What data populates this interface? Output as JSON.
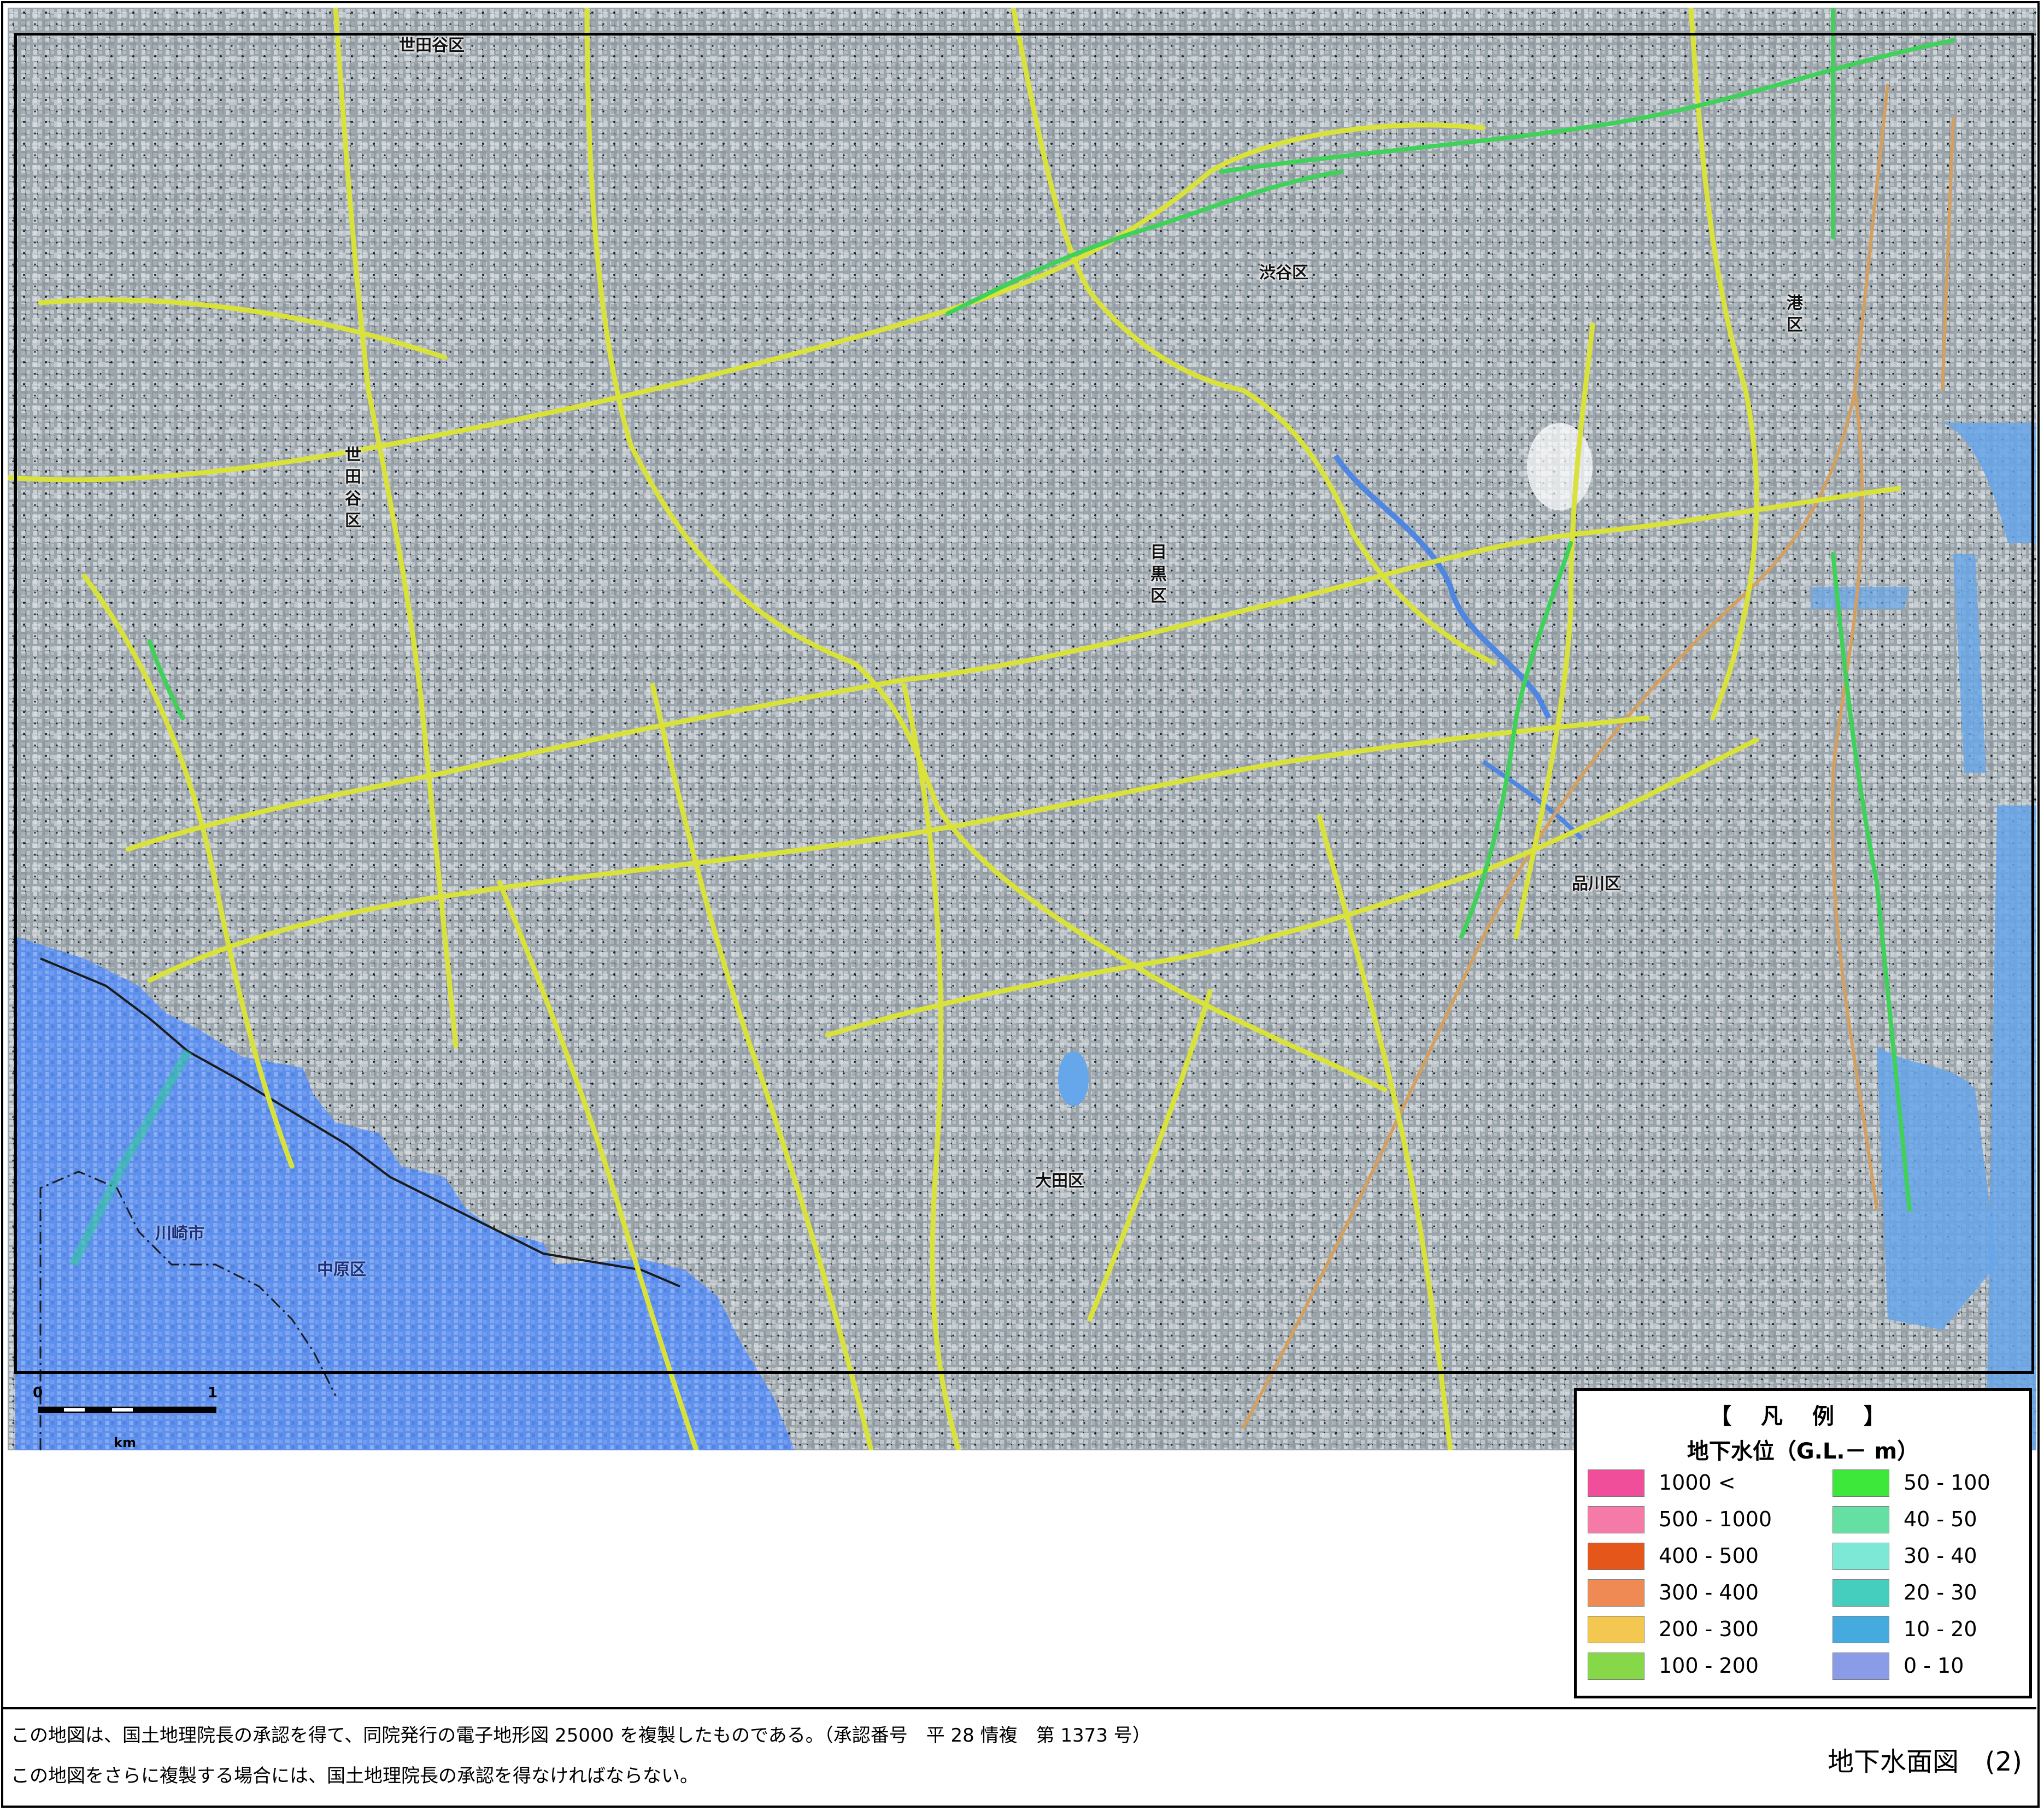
{
  "map": {
    "ward_labels": {
      "setagaya_top": "世田谷区",
      "setagaya_left": "世田谷区",
      "shibuya": "渋谷区",
      "minato": "港区",
      "meguro": "目黒区",
      "shinagawa": "品川区",
      "ota": "大田区",
      "kawasaki": "川崎市",
      "nakahara": "中原区"
    },
    "colors": {
      "base_map": "#9aa4ab",
      "roads": "#d8e23a",
      "green_roads": "#3fd15a",
      "railway": "#d4a060",
      "water": "#6d96d8",
      "groundwater_0_10": "#5b8ff0"
    }
  },
  "scale_bar": {
    "tick_start": "0",
    "tick_end": "1",
    "unit": "km"
  },
  "legend": {
    "title": "【 凡 例 】",
    "subtitle": "地下水位（G.L.－ m）",
    "items_left": [
      {
        "label": "1000 <",
        "color": "#f04e9a"
      },
      {
        "label": "500 - 1000",
        "color": "#f57aa7"
      },
      {
        "label": "400 - 500",
        "color": "#e4561a"
      },
      {
        "label": "300 - 400",
        "color": "#f08a55"
      },
      {
        "label": "200 - 300",
        "color": "#f4c850"
      },
      {
        "label": "100 - 200",
        "color": "#86d848"
      }
    ],
    "items_right": [
      {
        "label": "50 - 100",
        "color": "#3ee83a"
      },
      {
        "label": "40 - 50",
        "color": "#66dfa2"
      },
      {
        "label": "30 - 40",
        "color": "#7ee8d6"
      },
      {
        "label": "20 - 30",
        "color": "#45cdbd"
      },
      {
        "label": "10 - 20",
        "color": "#45aade"
      },
      {
        "label": "0 - 10",
        "color": "#8a9be8"
      }
    ]
  },
  "footer": {
    "line1": "この地図は、国土地理院長の承認を得て、同院発行の電子地形図 25000 を複製したものである。（承認番号　平 28 情複　第 1373 号）",
    "line2": "この地図をさらに複製する場合には、国土地理院長の承認を得なければならない。",
    "title": "地下水面図　(2)"
  }
}
